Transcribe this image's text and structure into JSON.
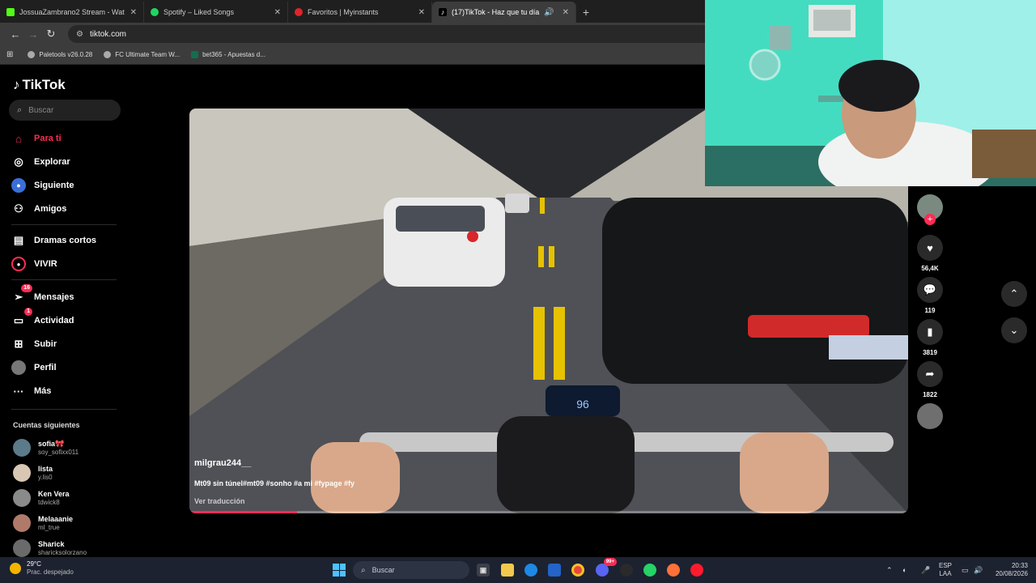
{
  "browser": {
    "tabs": [
      {
        "title": "JossuaZambrano2 Stream - Wat",
        "favicon_color": "#53fc18",
        "icon": "kick-icon"
      },
      {
        "title": "Spotify – Liked Songs",
        "favicon_color": "#1ed760",
        "icon": "spotify-icon"
      },
      {
        "title": "Favoritos | Myinstants",
        "favicon_color": "#e0242a",
        "icon": "myinstants-icon"
      },
      {
        "title": "(17)TikTok - Haz que tu día",
        "favicon_color": "#ffffff",
        "icon": "tiktok-icon"
      }
    ],
    "url": "tiktok.com",
    "bookmarks": [
      {
        "label": "Paletools v26.0.28"
      },
      {
        "label": "FC Ultimate Team W..."
      },
      {
        "label": "bet365 - Apuestas d..."
      }
    ]
  },
  "tiktok": {
    "logo": "TikTok",
    "search_placeholder": "Buscar",
    "nav": [
      {
        "label": "Para ti",
        "icon": "home-icon",
        "active": true
      },
      {
        "label": "Explorar",
        "icon": "compass-icon"
      },
      {
        "label": "Siguiente",
        "icon": "following-icon"
      },
      {
        "label": "Amigos",
        "icon": "friends-icon"
      },
      {
        "label": "Dramas cortos",
        "icon": "drama-icon"
      },
      {
        "label": "VIVIR",
        "icon": "live-icon"
      },
      {
        "label": "Mensajes",
        "icon": "messages-icon",
        "badge": "16"
      },
      {
        "label": "Actividad",
        "icon": "activity-icon",
        "badge": "1"
      },
      {
        "label": "Subir",
        "icon": "upload-icon"
      },
      {
        "label": "Perfil",
        "icon": "profile-icon"
      },
      {
        "label": "Más",
        "icon": "more-icon"
      }
    ],
    "following_header": "Cuentas siguientes",
    "following": [
      {
        "name": "sofia🎀",
        "handle": "soy_sofixx011"
      },
      {
        "name": "lista",
        "handle": "y.lis0"
      },
      {
        "name": "Ken Vera",
        "handle": "tdwick8"
      },
      {
        "name": "Melaaanie",
        "handle": "ml_true"
      },
      {
        "name": "Sharick",
        "handle": "sharicksolorzano"
      }
    ],
    "video": {
      "author": "milgrau244__",
      "caption": "Mt09 sin túnel#mt09 #sonho #a mi #fypage #fy",
      "translate": "Ver traducción",
      "progress": 0.15,
      "speedometer": "96"
    },
    "actions": {
      "likes": "56,4K",
      "comments": "119",
      "saves": "3819",
      "shares": "1822"
    }
  },
  "taskbar": {
    "weather_temp": "29°C",
    "weather_desc": "Prac. despejado",
    "search_placeholder": "Buscar",
    "lang_top": "ESP",
    "lang_bottom": "LAA",
    "time": "20:33",
    "date": "20/08/2026",
    "discord_badge": "99+"
  }
}
